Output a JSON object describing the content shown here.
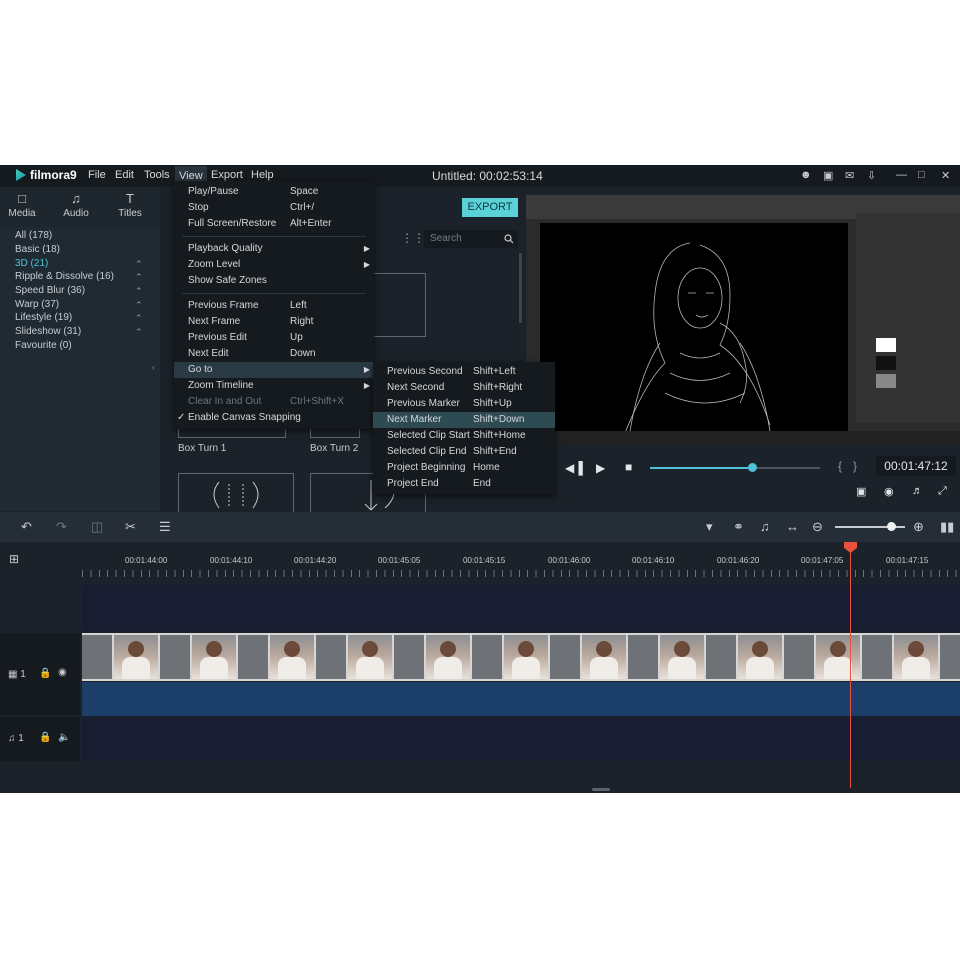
{
  "app": {
    "name": "filmora9",
    "title": "Untitled:  00:02:53:14",
    "menu": [
      "File",
      "Edit",
      "Tools",
      "View",
      "Export",
      "Help"
    ]
  },
  "tabs": [
    {
      "label": "Media",
      "icon": "folder-icon"
    },
    {
      "label": "Audio",
      "icon": "music-note-icon"
    },
    {
      "label": "Titles",
      "icon": "title-text-icon"
    }
  ],
  "categories": [
    {
      "label": "All (178)"
    },
    {
      "label": "Basic (18)"
    },
    {
      "label": "3D (21)",
      "selected": true
    },
    {
      "label": "Ripple & Dissolve (16)"
    },
    {
      "label": "Speed Blur (36)"
    },
    {
      "label": "Warp (37)"
    },
    {
      "label": "Lifestyle (19)"
    },
    {
      "label": "Slideshow (31)"
    },
    {
      "label": "Favourite (0)"
    }
  ],
  "library": {
    "export_label": "EXPORT",
    "search_placeholder": "Search",
    "thumbs": [
      "Box Turn 1",
      "Box Turn 2"
    ]
  },
  "preview": {
    "timecode": "00:01:47:12",
    "progress": 0.6
  },
  "view_menu": [
    {
      "label": "Play/Pause",
      "shortcut": "Space"
    },
    {
      "label": "Stop",
      "shortcut": "Ctrl+/"
    },
    {
      "label": "Full Screen/Restore",
      "shortcut": "Alt+Enter"
    },
    {
      "sep": true
    },
    {
      "label": "Playback Quality",
      "shortcut": "",
      "submenu": true
    },
    {
      "label": "Zoom Level",
      "shortcut": "",
      "submenu": true
    },
    {
      "label": "Show Safe Zones",
      "shortcut": ""
    },
    {
      "sep": true
    },
    {
      "label": "Previous Frame",
      "shortcut": "Left"
    },
    {
      "label": "Next Frame",
      "shortcut": "Right"
    },
    {
      "label": "Previous Edit",
      "shortcut": "Up"
    },
    {
      "label": "Next Edit",
      "shortcut": "Down"
    },
    {
      "label": "Go to",
      "shortcut": "",
      "submenu": true,
      "highlight": true
    },
    {
      "label": "Zoom Timeline",
      "shortcut": "",
      "submenu": true
    },
    {
      "label": "Clear In and Out",
      "shortcut": "Ctrl+Shift+X",
      "disabled": true
    },
    {
      "label": "Enable Canvas Snapping",
      "shortcut": "",
      "checked": true
    }
  ],
  "goto_menu": [
    {
      "label": "Previous Second",
      "shortcut": "Shift+Left"
    },
    {
      "label": "Next Second",
      "shortcut": "Shift+Right"
    },
    {
      "label": "Previous Marker",
      "shortcut": "Shift+Up"
    },
    {
      "label": "Next Marker",
      "shortcut": "Shift+Down",
      "highlight": true
    },
    {
      "label": "Selected Clip Start",
      "shortcut": "Shift+Home"
    },
    {
      "label": "Selected Clip End",
      "shortcut": "Shift+End"
    },
    {
      "label": "Project Beginning",
      "shortcut": "Home"
    },
    {
      "label": "Project End",
      "shortcut": "End"
    }
  ],
  "timeline": {
    "ruler_labels": [
      "00:01:44:00",
      "00:01:44:10",
      "00:01:44:20",
      "00:01:45:05",
      "00:01:45:15",
      "00:01:46:00",
      "00:01:46:10",
      "00:01:46:20",
      "00:01:47:05",
      "00:01:47:15"
    ],
    "video_track_label": "1",
    "audio_track_label": "1",
    "zoom": 0.8
  },
  "colors": {
    "accent": "#4fc3d6",
    "export": "#5ad2d8",
    "playhead": "#e8513a",
    "audio_track": "#1c3f6a"
  }
}
